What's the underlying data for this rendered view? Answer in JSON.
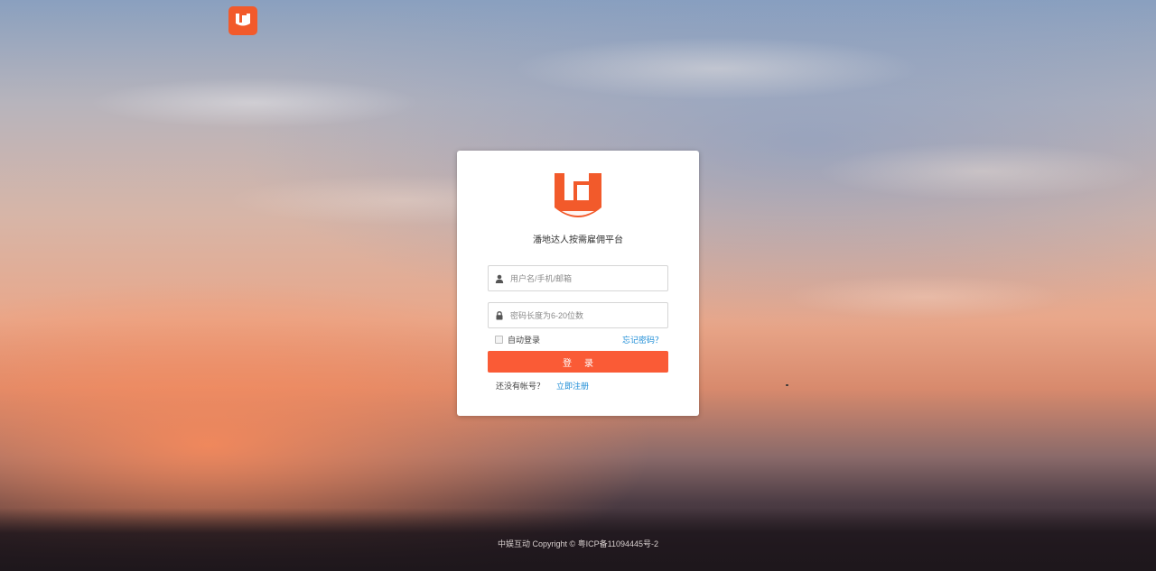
{
  "brand": {
    "accent_color": "#f25a2b",
    "button_color": "#fa5b36",
    "link_color": "#1a8bd6",
    "logo_icon": "ud-logo-icon"
  },
  "login": {
    "title": "潘地达人按需雇佣平台",
    "username_placeholder": "用户名/手机/邮箱",
    "password_placeholder": "密码长度为6-20位数",
    "remember_label": "自动登录",
    "forgot_label": "忘记密码？",
    "submit_label": "登录",
    "no_account_label": "还没有帐号？",
    "register_label": "立即注册",
    "user_icon": "user-icon",
    "lock_icon": "lock-icon"
  },
  "footer": {
    "copyright": "中娱互动 Copyright © 粤ICP备11094445号-2"
  }
}
